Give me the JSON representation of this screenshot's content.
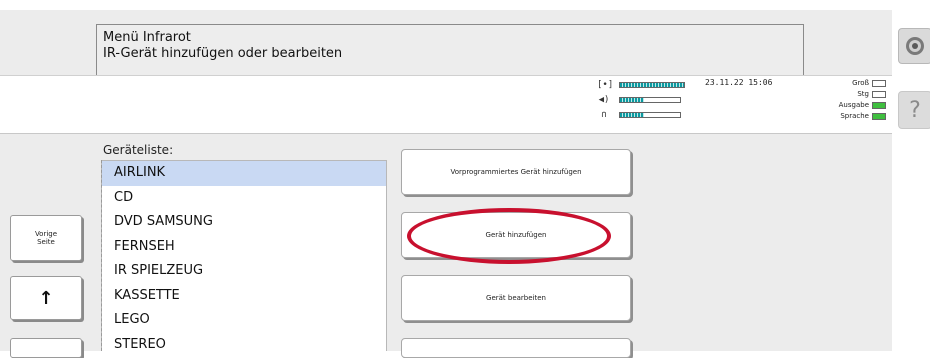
{
  "header": {
    "line1": "Menü Infrarot",
    "line2": "IR-Gerät hinzufügen oder bearbeiten"
  },
  "status": {
    "datetime": "23.11.22 15:06",
    "levels": [
      {
        "icon": "speaker-icon",
        "glyph": "[•]",
        "fill_percent": 100
      },
      {
        "icon": "volume-icon",
        "glyph": "◀)",
        "fill_percent": 40
      },
      {
        "icon": "headphones-icon",
        "glyph": "∩",
        "fill_percent": 40
      }
    ],
    "indicators": [
      {
        "label": "Groß",
        "on": false
      },
      {
        "label": "Stg",
        "on": false
      },
      {
        "label": "Ausgabe",
        "on": true
      },
      {
        "label": "Sprache",
        "on": true
      }
    ]
  },
  "device_list": {
    "title": "Geräteliste:",
    "items": [
      "AIRLINK",
      "CD",
      "DVD SAMSUNG",
      "FERNSEH",
      "IR SPIELZEUG",
      "KASSETTE",
      "LEGO",
      "STEREO"
    ],
    "selected_index": 0
  },
  "side_buttons": {
    "prev_page": "Vorige\nSeite",
    "up_arrow": "↑"
  },
  "actions": {
    "add_preset": "Vorprogrammiertes Gerät hinzufügen",
    "add_device": "Gerät hinzufügen",
    "edit_device": "Gerät bearbeiten"
  },
  "corner": {
    "help_glyph": "?"
  },
  "colors": {
    "selection": "#c9d9f3",
    "highlight_ring": "#c8102e",
    "indicator_on": "#3fbf3f",
    "level_fill": "#0c9aa0"
  }
}
